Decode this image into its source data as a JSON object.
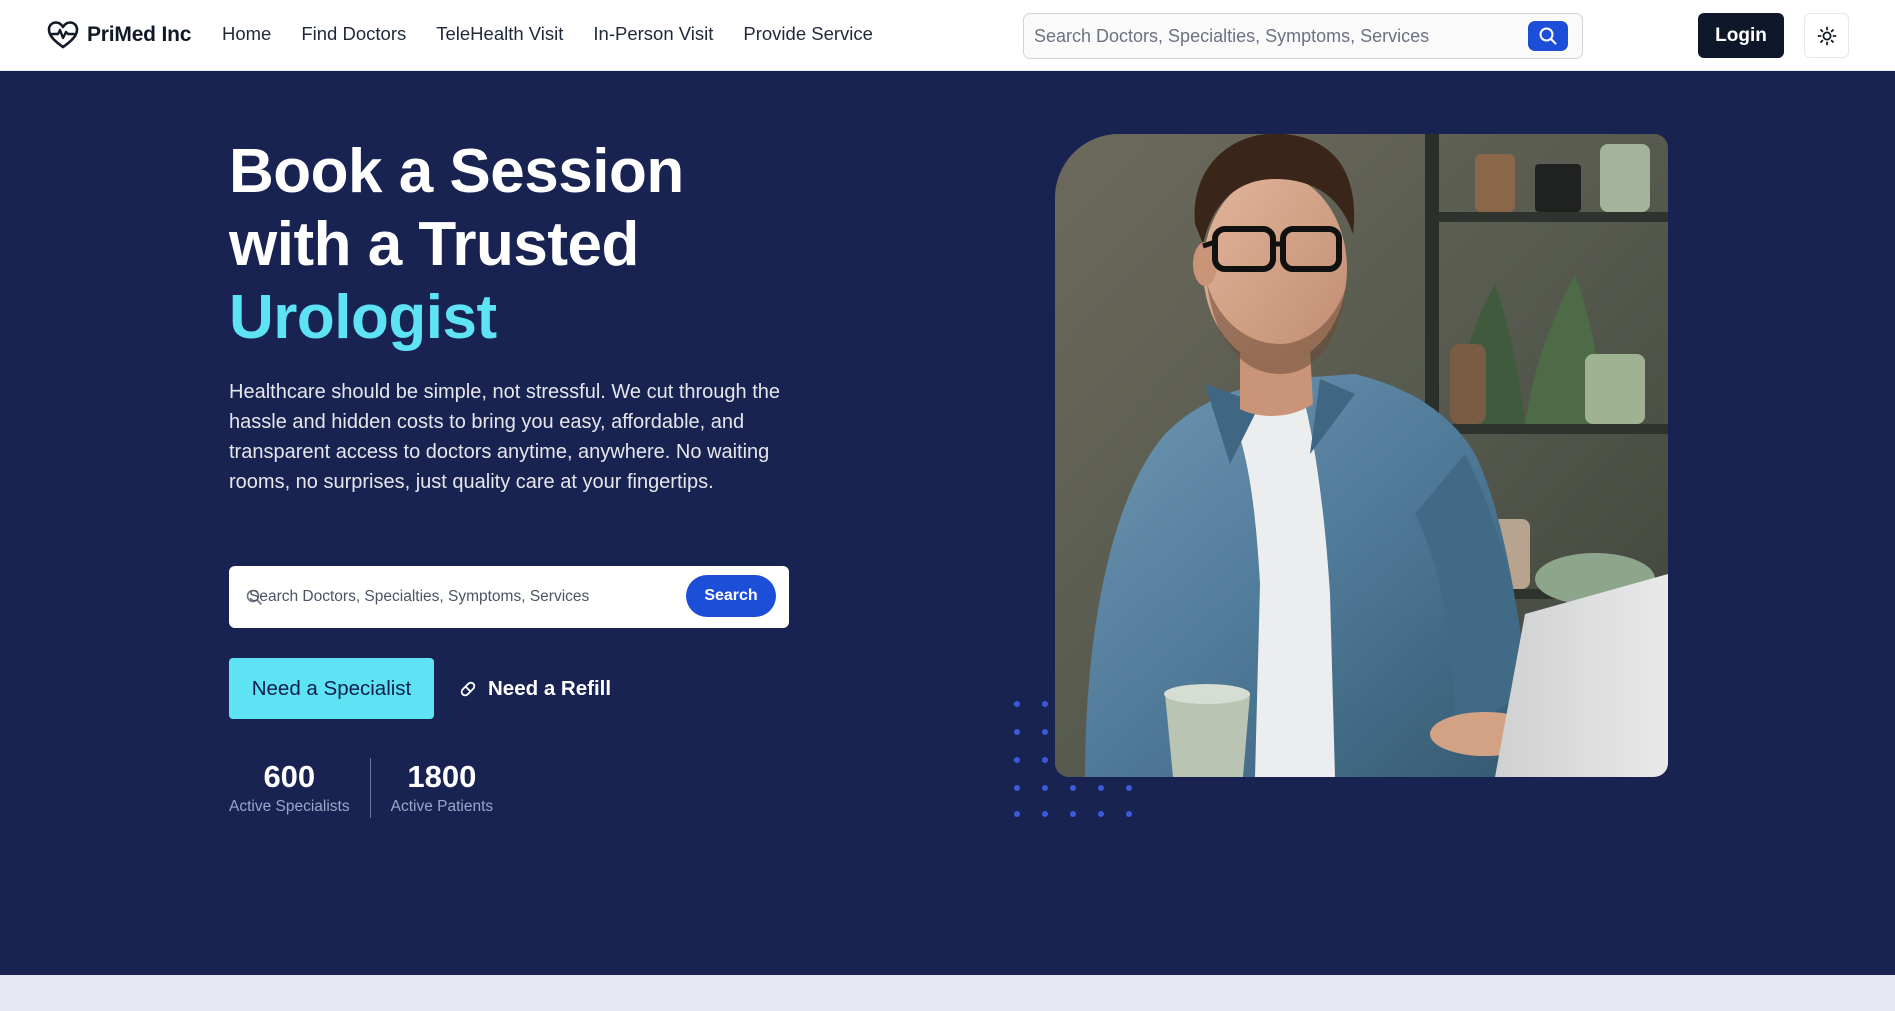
{
  "brand": {
    "name": "PriMed Inc",
    "icon": "heart-pulse-icon"
  },
  "nav": {
    "links": [
      {
        "label": "Home"
      },
      {
        "label": "Find Doctors"
      },
      {
        "label": "TeleHealth Visit"
      },
      {
        "label": "In-Person Visit"
      },
      {
        "label": "Provide Service"
      }
    ],
    "search": {
      "placeholder": "Search Doctors, Specialties, Symptoms, Services",
      "icon": "search-icon"
    },
    "login_label": "Login",
    "theme_icon": "sun-icon"
  },
  "hero": {
    "title_line1": "Book a Session",
    "title_line2": "with a Trusted",
    "title_accent": "Urologist",
    "description": "Healthcare should be simple, not stressful. We cut through the hassle and hidden costs to bring you easy, affordable, and transparent access to doctors anytime, anywhere. No waiting rooms, no surprises, just quality care at your fingertips.",
    "search": {
      "placeholder": "Search Doctors, Specialties, Symptoms, Services",
      "button_label": "Search"
    },
    "specialist_label": "Need a Specialist",
    "refill_label": "Need a Refill",
    "refill_icon": "pill-icon",
    "stats": [
      {
        "value": "600",
        "label": "Active Specialists"
      },
      {
        "value": "1800",
        "label": "Active Patients"
      }
    ]
  },
  "colors": {
    "hero_bg": "#182352",
    "accent": "#5ee3f5",
    "primary": "#1d4ed8",
    "dark": "#0f172a"
  }
}
